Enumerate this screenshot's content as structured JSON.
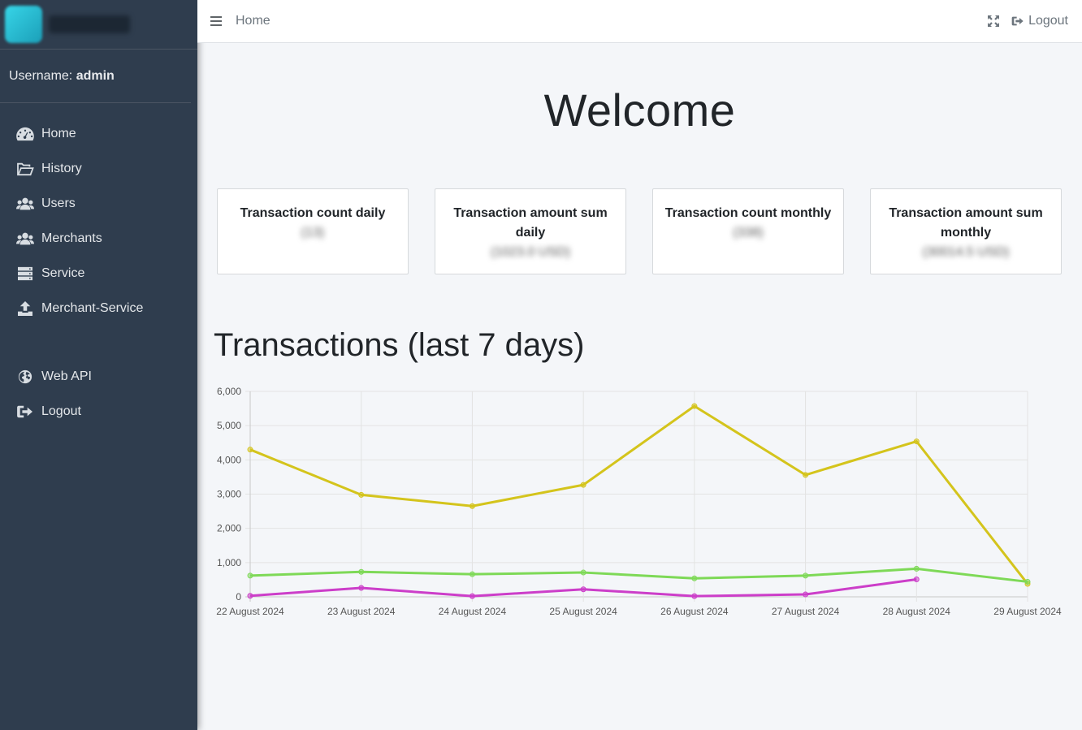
{
  "sidebar": {
    "username_label": "Username:",
    "username": "admin",
    "items": [
      {
        "label": "Home",
        "icon": "dashboard-icon"
      },
      {
        "label": "History",
        "icon": "folder-open-icon"
      },
      {
        "label": "Users",
        "icon": "users-icon"
      },
      {
        "label": "Merchants",
        "icon": "users-icon"
      },
      {
        "label": "Service",
        "icon": "server-icon"
      },
      {
        "label": "Merchant-Service",
        "icon": "upload-icon"
      }
    ],
    "secondary_items": [
      {
        "label": "Web API",
        "icon": "globe-icon"
      },
      {
        "label": "Logout",
        "icon": "sign-out-icon"
      }
    ]
  },
  "topbar": {
    "breadcrumb": "Home",
    "logout_label": "Logout"
  },
  "main": {
    "welcome": "Welcome",
    "cards": [
      {
        "title": "Transaction count daily",
        "value": "(13)"
      },
      {
        "title": "Transaction amount sum daily",
        "value": "(1023.0 USD)"
      },
      {
        "title": "Transaction count monthly",
        "value": "(338)"
      },
      {
        "title": "Transaction amount sum monthly",
        "value": "(30014.5 USD)"
      }
    ],
    "chart_title": "Transactions (last 7 days)"
  },
  "chart_data": {
    "type": "line",
    "title": "",
    "xlabel": "",
    "ylabel": "",
    "ylim": [
      0,
      6000
    ],
    "yticks": [
      "0",
      "1,000",
      "2,000",
      "3,000",
      "4,000",
      "5,000",
      "6,000"
    ],
    "categories": [
      "22 August 2024",
      "23 August 2024",
      "24 August 2024",
      "25 August 2024",
      "26 August 2024",
      "27 August 2024",
      "28 August 2024",
      "29 August 2024"
    ],
    "grid": true,
    "series": [
      {
        "color": "#d4c41c",
        "values": [
          4300,
          2980,
          2650,
          3270,
          5570,
          3560,
          4540,
          380
        ]
      },
      {
        "color": "#7ed957",
        "values": [
          620,
          730,
          660,
          710,
          540,
          620,
          820,
          440
        ]
      },
      {
        "color": "#cc3ec9",
        "values": [
          30,
          260,
          20,
          220,
          20,
          70,
          510,
          null
        ]
      }
    ]
  }
}
